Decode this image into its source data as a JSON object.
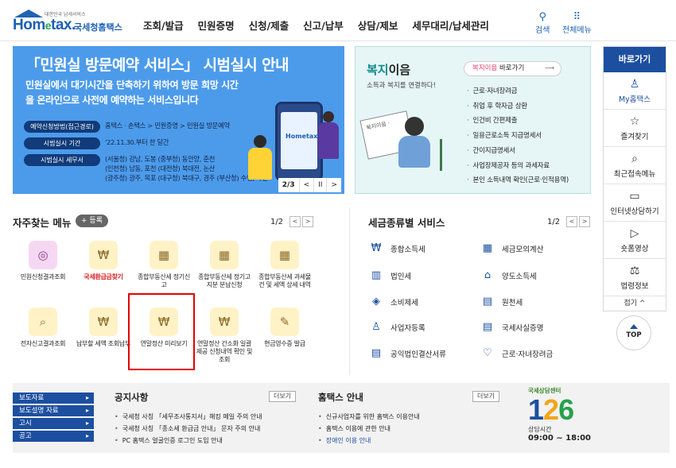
{
  "header": {
    "logo_sub": "대한민국 납세서비스",
    "logo_word_a": "Hom",
    "logo_word_e": "e",
    "logo_word_b": "tax.",
    "logo_kor": "국세청홈택스",
    "nav": [
      "조회/발급",
      "민원증명",
      "신청/제출",
      "신고/납부",
      "상담/제보",
      "세무대리/납세관리"
    ],
    "search_label": "검색",
    "allmenu_label": "전체메뉴"
  },
  "banner": {
    "title": "「민원실 방문예약 서비스」 시범실시 안내",
    "desc": "민원실에서 대기시간을 단축하기 위하여 방문 희망 시간을 온라인으로 사전에 예약하는 서비스입니다",
    "rows": [
      {
        "pill": "예약신청방법(접근경로)",
        "value": "홈택스 · 손택스 > 민원증명 > 민원실 방문예약"
      },
      {
        "pill": "시범실시 기간",
        "value": "'22.11.30.부터 한 달간"
      },
      {
        "pill": "시범실시 세무서",
        "value_lines": [
          "(서울청) 강남, 도봉 (중부청) 동안양, 춘천",
          "(인천청) 남동, 포천 (대전청) 북대전, 논산",
          "(광주청) 광주, 목포 (대구청) 북대구, 경주 (부산청) 수영, 마산"
        ]
      }
    ],
    "phone_brand": "Hometax",
    "pager": {
      "current": "2/3",
      "prev": "<",
      "pause": "II",
      "next": ">"
    }
  },
  "welfare": {
    "title_a": "복지",
    "title_b": "이음",
    "subtitle": "소득과 복지를 연결하다!",
    "go_hl": "복지이음",
    "go_rest": " 바로가기",
    "go_arrow": "⟶",
    "paper_text": "복지이음 ·",
    "items": [
      "근로·자녀장려금",
      "취업 후 학자금 상환",
      "인건비 간편제출",
      "일용근로소득 지급명세서",
      "간이지급명세서",
      "사업장제공자 등의 과세자료",
      "본인 소득내역 확인(근로·인적용역)"
    ]
  },
  "quick": {
    "title": "바로가기",
    "items": [
      {
        "icon": "user-icon",
        "glyph": "♙",
        "label": "My홈택스"
      },
      {
        "icon": "star-icon",
        "glyph": "☆",
        "label": "즐겨찾기"
      },
      {
        "icon": "recent-icon",
        "glyph": "⌕",
        "label": "최근접속메뉴"
      },
      {
        "icon": "monitor-icon",
        "glyph": "▭",
        "label": "인터넷상담하기"
      },
      {
        "icon": "video-icon",
        "glyph": "▷",
        "label": "숏폼영상"
      },
      {
        "icon": "gavel-icon",
        "glyph": "⚖",
        "label": "법령정보"
      }
    ],
    "fold": "접기 ^",
    "top": "TOP"
  },
  "frequent": {
    "title": "자주찾는 메뉴",
    "register": "+ 등록",
    "page": "1/2",
    "prev": "<",
    "next": ">",
    "tiles": [
      {
        "icon": "headset-icon",
        "glyph": "◎",
        "label": "민원신청결과조회"
      },
      {
        "icon": "refund-icon",
        "glyph": "₩",
        "label": "국세환급금찾기"
      },
      {
        "icon": "calendar-icon",
        "glyph": "▦",
        "label": "종합부동산세 정기신고"
      },
      {
        "icon": "calendar-icon",
        "glyph": "▦",
        "label": "종합부동산세 정기고지분 분납신청"
      },
      {
        "icon": "calendar-icon",
        "glyph": "▦",
        "label": "종합부동산세 과세물건 및 세액 상세 내역"
      },
      {
        "icon": "docsearch-icon",
        "glyph": "⌕",
        "label": "전자신고결과조회"
      },
      {
        "icon": "moneybag-icon",
        "glyph": "₩",
        "label": "납부할 세액 조회납부"
      },
      {
        "icon": "money-search-icon",
        "glyph": "₩",
        "label": "연말정산 미리보기"
      },
      {
        "icon": "moneybag-icon",
        "glyph": "₩",
        "label": "연말정산 간소화 일괄제공 신청내역 확인 및 조회"
      },
      {
        "icon": "receipt-icon",
        "glyph": "✎",
        "label": "현금영수증 발급"
      }
    ]
  },
  "services": {
    "title": "세금종류별 서비스",
    "page": "1/2",
    "prev": "<",
    "next": ">",
    "items": [
      {
        "icon": "income-tax-icon",
        "glyph": "₩",
        "label": "종합소득세"
      },
      {
        "icon": "calculator-icon",
        "glyph": "▦",
        "label": "세금모의계산"
      },
      {
        "icon": "building-icon",
        "glyph": "▥",
        "label": "법인세"
      },
      {
        "icon": "house-icon",
        "glyph": "⌂",
        "label": "양도소득세"
      },
      {
        "icon": "gem-icon",
        "glyph": "◈",
        "label": "소비제세"
      },
      {
        "icon": "withholding-icon",
        "glyph": "▤",
        "label": "원천세"
      },
      {
        "icon": "registration-icon",
        "glyph": "♙",
        "label": "사업자등록"
      },
      {
        "icon": "certificate-icon",
        "glyph": "▤",
        "label": "국세사실증명"
      },
      {
        "icon": "corporate-doc-icon",
        "glyph": "▤",
        "label": "공익법인결산서류"
      },
      {
        "icon": "heart-icon",
        "glyph": "♡",
        "label": "근로·자녀장려금"
      }
    ]
  },
  "footer": {
    "links": [
      "보도자료",
      "보도설명 자료",
      "고시",
      "공고"
    ],
    "notice_title": "공지사항",
    "notice_more": "더보기",
    "notices": [
      "국세청 사칭 「세무조사통지서」해킹 메일 주의 안내",
      "국세청 사칭 「종소세 환급금 안내」 문자 주의 안내",
      "PC 홈택스 얼굴인증 로그인 도입 안내"
    ],
    "guide_title": "홈택스 안내",
    "guide_more": "더보기",
    "guides": [
      "신규사업자를 위한 홈택스 이용안내",
      "홈택스 이용에 관한 안내",
      "장애인 이용 안내"
    ],
    "center_caption": "국세상담센터",
    "center_d1": "1",
    "center_d2": "2",
    "center_d3": "6",
    "hours_label": "상담시간",
    "hours": "09:00 ~ 18:00"
  }
}
